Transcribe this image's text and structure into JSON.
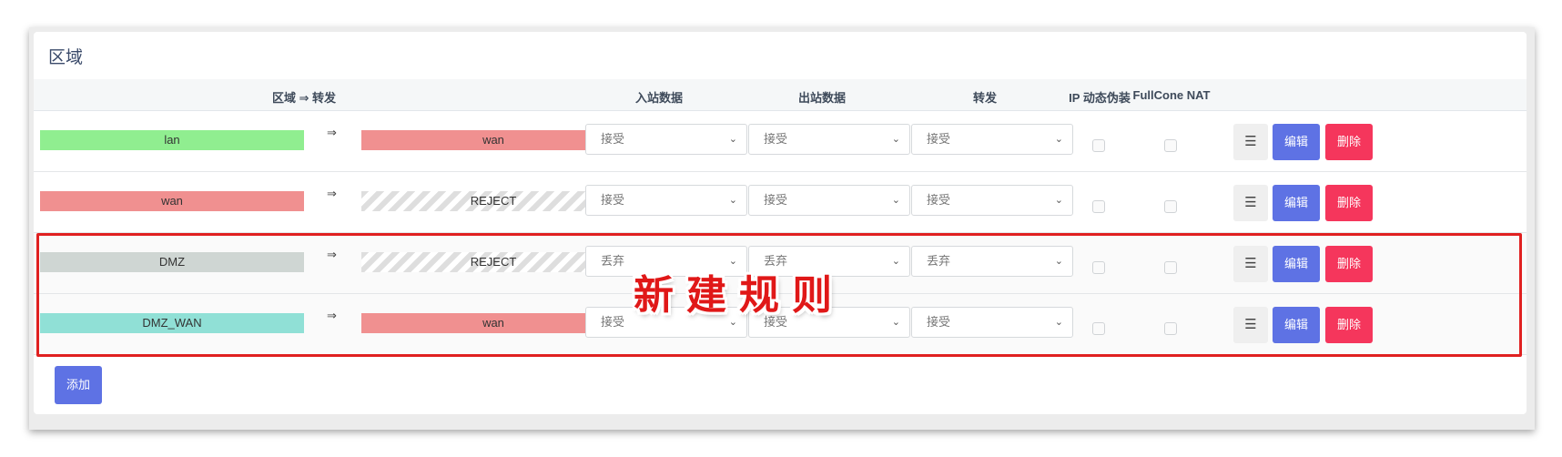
{
  "card": {
    "title": "区域"
  },
  "table": {
    "headers": {
      "zone_forward": "区域 ⇒ 转发",
      "inbound": "入站数据",
      "outbound": "出站数据",
      "forward": "转发",
      "masquerade": "IP 动态伪装",
      "fullcone": "FullCone NAT"
    },
    "rows": [
      {
        "zone": "lan",
        "zone_color": "#90ee90",
        "arrow": "⇒",
        "target": "wan",
        "target_color": "#f09090",
        "target_reject": false,
        "inbound": "接受",
        "outbound": "接受",
        "forward": "接受"
      },
      {
        "zone": "wan",
        "zone_color": "#f09090",
        "arrow": "⇒",
        "target": "REJECT",
        "target_color": "",
        "target_reject": true,
        "inbound": "接受",
        "outbound": "接受",
        "forward": "接受"
      },
      {
        "zone": "DMZ",
        "zone_color": "#cfd6d3",
        "arrow": "⇒",
        "target": "REJECT",
        "target_color": "",
        "target_reject": true,
        "inbound": "丢弃",
        "outbound": "丢弃",
        "forward": "丢弃"
      },
      {
        "zone": "DMZ_WAN",
        "zone_color": "#90e0d6",
        "arrow": "⇒",
        "target": "wan",
        "target_color": "#f09090",
        "target_reject": false,
        "inbound": "接受",
        "outbound": "接受",
        "forward": "接受"
      }
    ],
    "menu_label": "☰",
    "edit_label": "编辑",
    "delete_label": "删除"
  },
  "add_label": "添加",
  "annotation": {
    "text": "新建规则",
    "color": "#e02020"
  },
  "colors": {
    "primary": "#5e72e4",
    "danger": "#f5365c"
  }
}
